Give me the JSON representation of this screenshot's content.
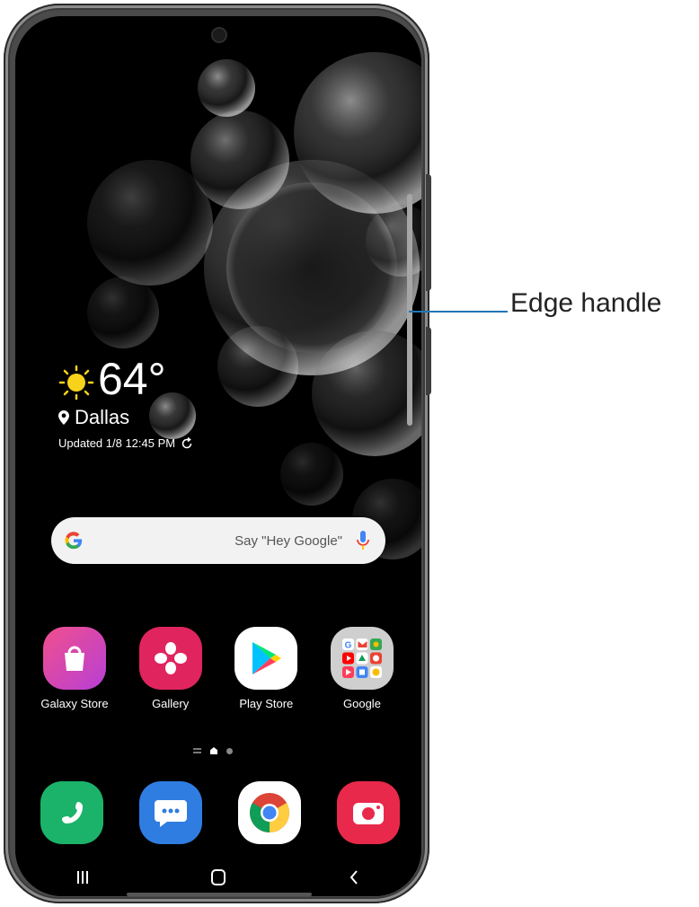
{
  "weather": {
    "temperature": "64°",
    "location": "Dallas",
    "updated": "Updated 1/8 12:45 PM"
  },
  "search": {
    "hint": "Say \"Hey Google\""
  },
  "home_apps": [
    {
      "label": "Galaxy Store",
      "icon": "galaxy-store-icon"
    },
    {
      "label": "Gallery",
      "icon": "gallery-icon"
    },
    {
      "label": "Play Store",
      "icon": "play-store-icon"
    },
    {
      "label": "Google",
      "icon": "google-folder-icon"
    }
  ],
  "dock_apps": [
    {
      "icon": "phone-icon"
    },
    {
      "icon": "messages-icon"
    },
    {
      "icon": "chrome-icon"
    },
    {
      "icon": "camera-icon"
    }
  ],
  "nav": {
    "recents": "recents-icon",
    "home": "home-icon",
    "back": "back-icon"
  },
  "callout": {
    "label": "Edge handle"
  },
  "colors": {
    "callout_line": "#1f77b4",
    "screen_bg": "#000000"
  }
}
